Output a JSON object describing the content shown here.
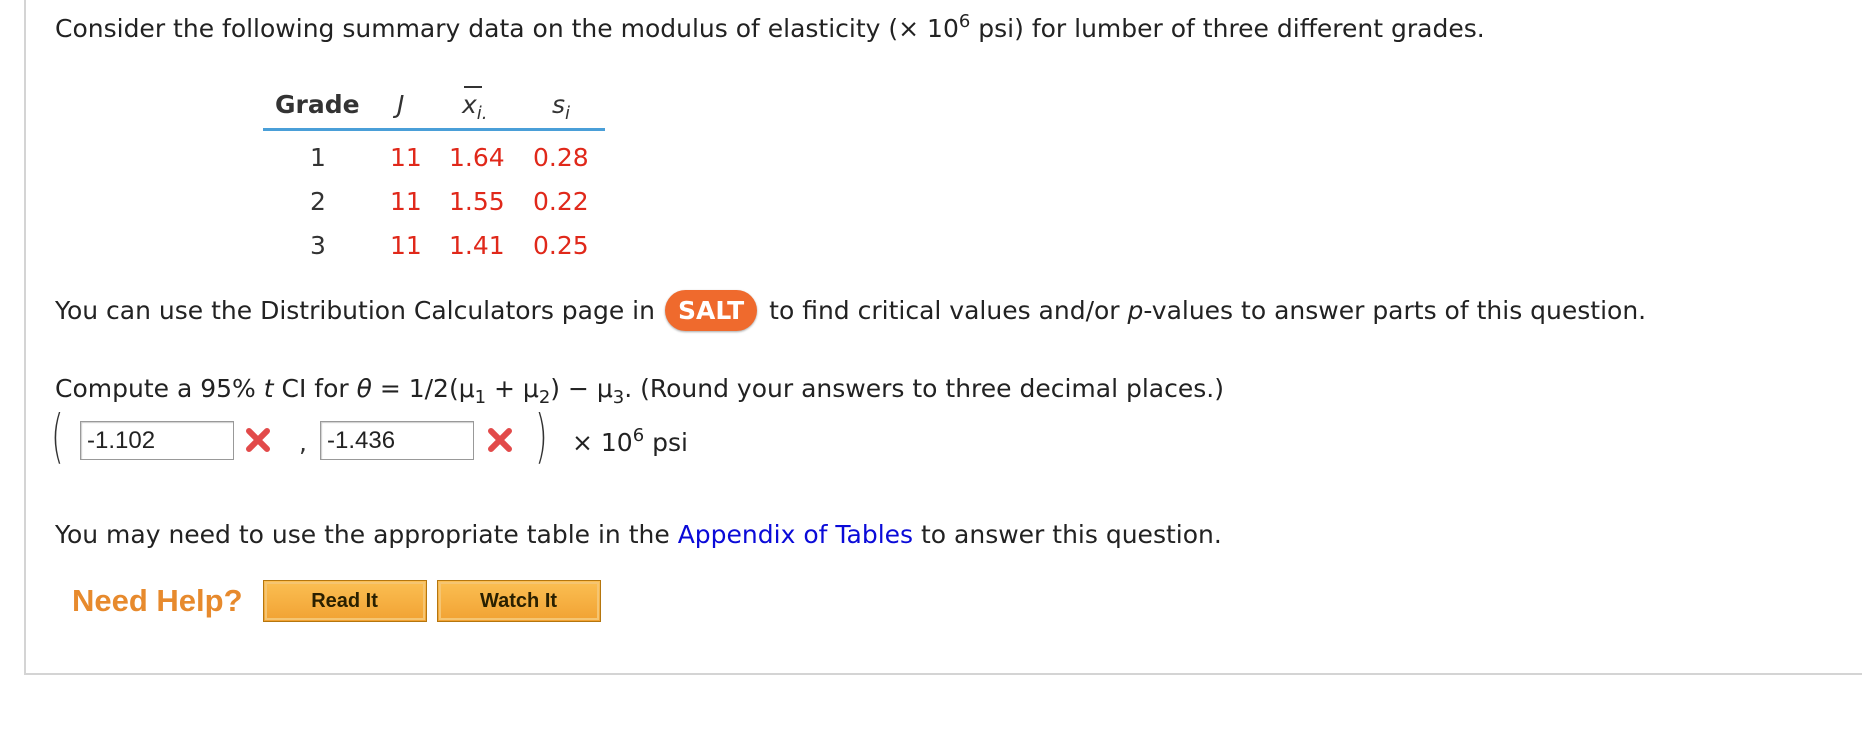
{
  "intro": {
    "text_before": "Consider the following summary data on the modulus of elasticity (× 10",
    "superscript": "6",
    "text_after": " psi) for lumber of three different grades."
  },
  "table": {
    "headers": {
      "grade": "Grade",
      "j": "J",
      "x": "x",
      "x_sub": "i.",
      "s": "s",
      "s_sub": "i"
    },
    "rows": [
      {
        "grade": "1",
        "j": "11",
        "x": "1.64",
        "s": "0.28"
      },
      {
        "grade": "2",
        "j": "11",
        "x": "1.55",
        "s": "0.22"
      },
      {
        "grade": "3",
        "j": "11",
        "x": "1.41",
        "s": "0.25"
      }
    ]
  },
  "salt": {
    "before": "You can use the Distribution Calculators page in",
    "button": "SALT",
    "after_1": "to find critical values and/or ",
    "after_p": "p",
    "after_2": "-values to answer parts of this question."
  },
  "question": {
    "prefix": "Compute a 95% ",
    "t": "t",
    "ci": " CI for ",
    "theta": "θ",
    "eq": " = 1/2(μ",
    "sub1": "1",
    "plus": " + μ",
    "sub2": "2",
    "minus": ") − μ",
    "sub3": "3",
    "suffix": ". (Round your answers to three decimal places.)"
  },
  "answer": {
    "lower_value": "-1.102",
    "upper_value": "-1.436",
    "lower_status": "incorrect",
    "upper_status": "incorrect",
    "unit_before": "× 10",
    "unit_sup": "6",
    "unit_after": " psi"
  },
  "appendix": {
    "before": "You may need to use the appropriate table in the ",
    "link": "Appendix of Tables",
    "after": " to answer this question."
  },
  "help": {
    "label": "Need Help?",
    "read_it": "Read It",
    "watch_it": "Watch It"
  },
  "colors": {
    "accent_blue": "#4a9fd8",
    "data_red": "#e0281a",
    "salt_orange": "#ef6a2d",
    "help_orange": "#e78a2d",
    "link_blue": "#0a0ad8",
    "error_red": "#e24a4a"
  }
}
